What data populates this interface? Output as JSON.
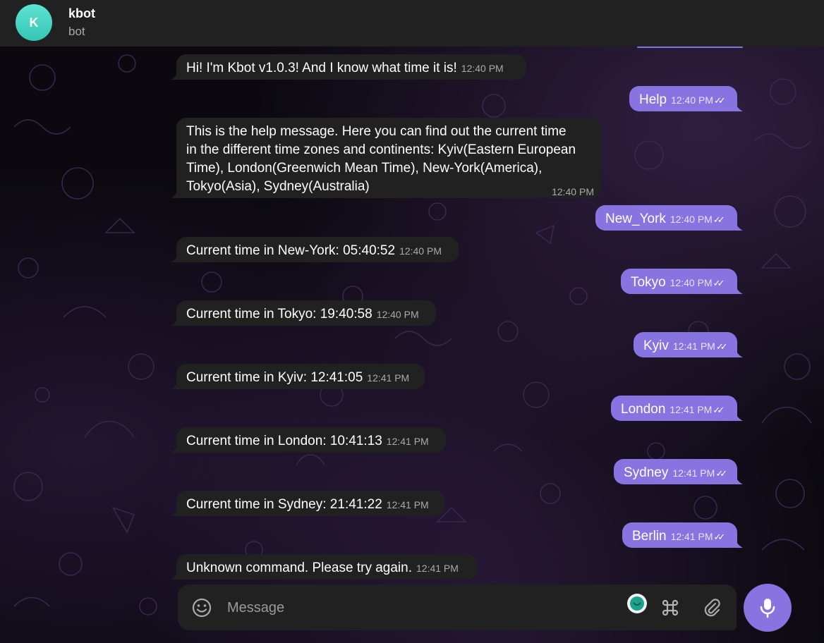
{
  "header": {
    "avatar_letter": "K",
    "title": "kbot",
    "subtitle": "bot"
  },
  "messages": [
    {
      "dir": "in",
      "text": "Hi! I'm Kbot v1.0.3! And I know what time it is!",
      "time": "12:40 PM"
    },
    {
      "dir": "out",
      "text": "Help",
      "time": "12:40 PM"
    },
    {
      "dir": "in",
      "lines": [
        "This is the help message. Here you can find out the current time",
        "in the different time zones and continents: Kyiv(Eastern European",
        "Time), London(Greenwich Mean Time), New-York(America),",
        "Tokyo(Asia), Sydney(Australia)"
      ],
      "time": "12:40 PM"
    },
    {
      "dir": "out",
      "text": "New_York",
      "time": "12:40 PM"
    },
    {
      "dir": "in",
      "text": "Current time in New-York: 05:40:52",
      "time": "12:40 PM"
    },
    {
      "dir": "out",
      "text": "Tokyo",
      "time": "12:40 PM"
    },
    {
      "dir": "in",
      "text": "Current time in Tokyo: 19:40:58",
      "time": "12:40 PM"
    },
    {
      "dir": "out",
      "text": "Kyiv",
      "time": "12:41 PM"
    },
    {
      "dir": "in",
      "text": "Current time in Kyiv: 12:41:05",
      "time": "12:41 PM"
    },
    {
      "dir": "out",
      "text": "London",
      "time": "12:41 PM"
    },
    {
      "dir": "in",
      "text": "Current time in London: 10:41:13",
      "time": "12:41 PM"
    },
    {
      "dir": "out",
      "text": "Sydney",
      "time": "12:41 PM"
    },
    {
      "dir": "in",
      "text": "Current time in Sydney: 21:41:22",
      "time": "12:41 PM"
    },
    {
      "dir": "out",
      "text": "Berlin",
      "time": "12:41 PM"
    },
    {
      "dir": "in",
      "text": "Unknown command. Please try again.",
      "time": "12:41 PM"
    }
  ],
  "composer": {
    "placeholder": "Message"
  },
  "icons": {
    "emoji": "emoji-icon",
    "bot_commands": "command-icon",
    "attach": "paperclip-icon",
    "mic": "microphone-icon",
    "status": "online-status-icon"
  },
  "colors": {
    "accent": "#8774e1",
    "bubble_in": "#212121",
    "avatar": "#3fd2c1"
  }
}
